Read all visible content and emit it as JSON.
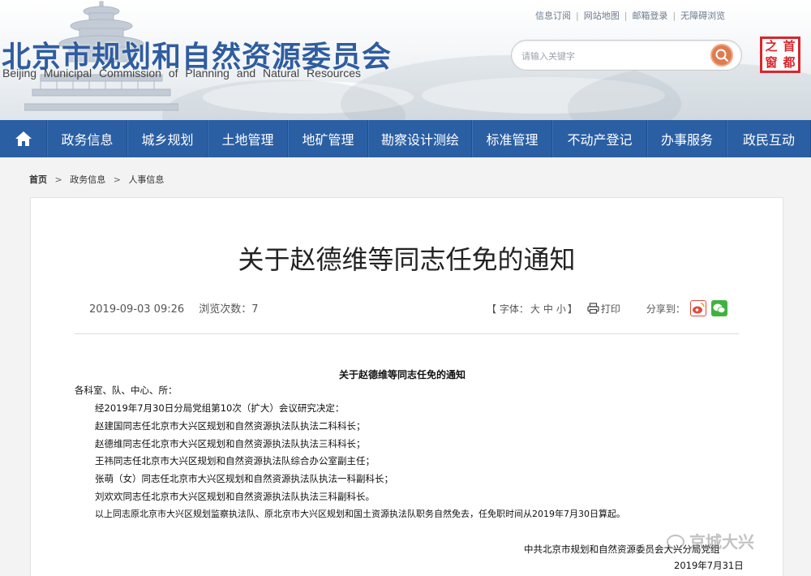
{
  "header": {
    "top_links": [
      "信息订阅",
      "网站地图",
      "邮箱登录",
      "无障碍浏览"
    ],
    "title_cn": "北京市规划和自然资源委员会",
    "title_en": "Beijing Municipal Commission of Planning and Natural Resources",
    "search_placeholder": "请输入关键字",
    "seal_chars": [
      "首",
      "之",
      "都",
      "窗"
    ]
  },
  "nav": {
    "items": [
      "政务信息",
      "城乡规划",
      "土地管理",
      "地矿管理",
      "勘察设计测绘",
      "标准管理",
      "不动产登记",
      "办事服务",
      "政民互动"
    ]
  },
  "breadcrumb": [
    "首页",
    "政务信息",
    "人事信息"
  ],
  "breadcrumb_sep": ">",
  "article": {
    "title": "关于赵德维等同志任免的通知",
    "date": "2019-09-03 09:26",
    "views": "浏览次数：7",
    "font_size_label": "【 字体：",
    "font_sizes": [
      "大",
      "中",
      "小"
    ],
    "font_size_end": "】",
    "print_label": "打印",
    "share_label": "分享到："
  },
  "document": {
    "title": "关于赵德维等同志任免的通知",
    "salutation": "各科室、队、中心、所：",
    "lines": [
      "经2019年7月30日分局党组第10次（扩大）会议研究决定：",
      "赵建国同志任北京市大兴区规划和自然资源执法队执法二科科长；",
      "赵德维同志任北京市大兴区规划和自然资源执法队执法三科科长；",
      "王祎同志任北京市大兴区规划和自然资源执法队综合办公室副主任；",
      "张萌（女）同志任北京市大兴区规划和自然资源执法队执法一科副科长；",
      "刘欢欢同志任北京市大兴区规划和自然资源执法队执法三科副科长。",
      "以上同志原北京市大兴区规划监察执法队、原北京市大兴区规划和国土资源执法队职务自然免去，任免职时间从2019年7月30日算起。"
    ],
    "signature": "中共北京市规划和自然资源委员会大兴分局党组",
    "sign_date": "2019年7月31日"
  },
  "watermark": "京城大兴",
  "colors": {
    "nav_bg": "#2a5fa4",
    "title_blue": "#2f5d9f",
    "seal_red": "#d8262c",
    "search_btn": "#e07a4f"
  }
}
